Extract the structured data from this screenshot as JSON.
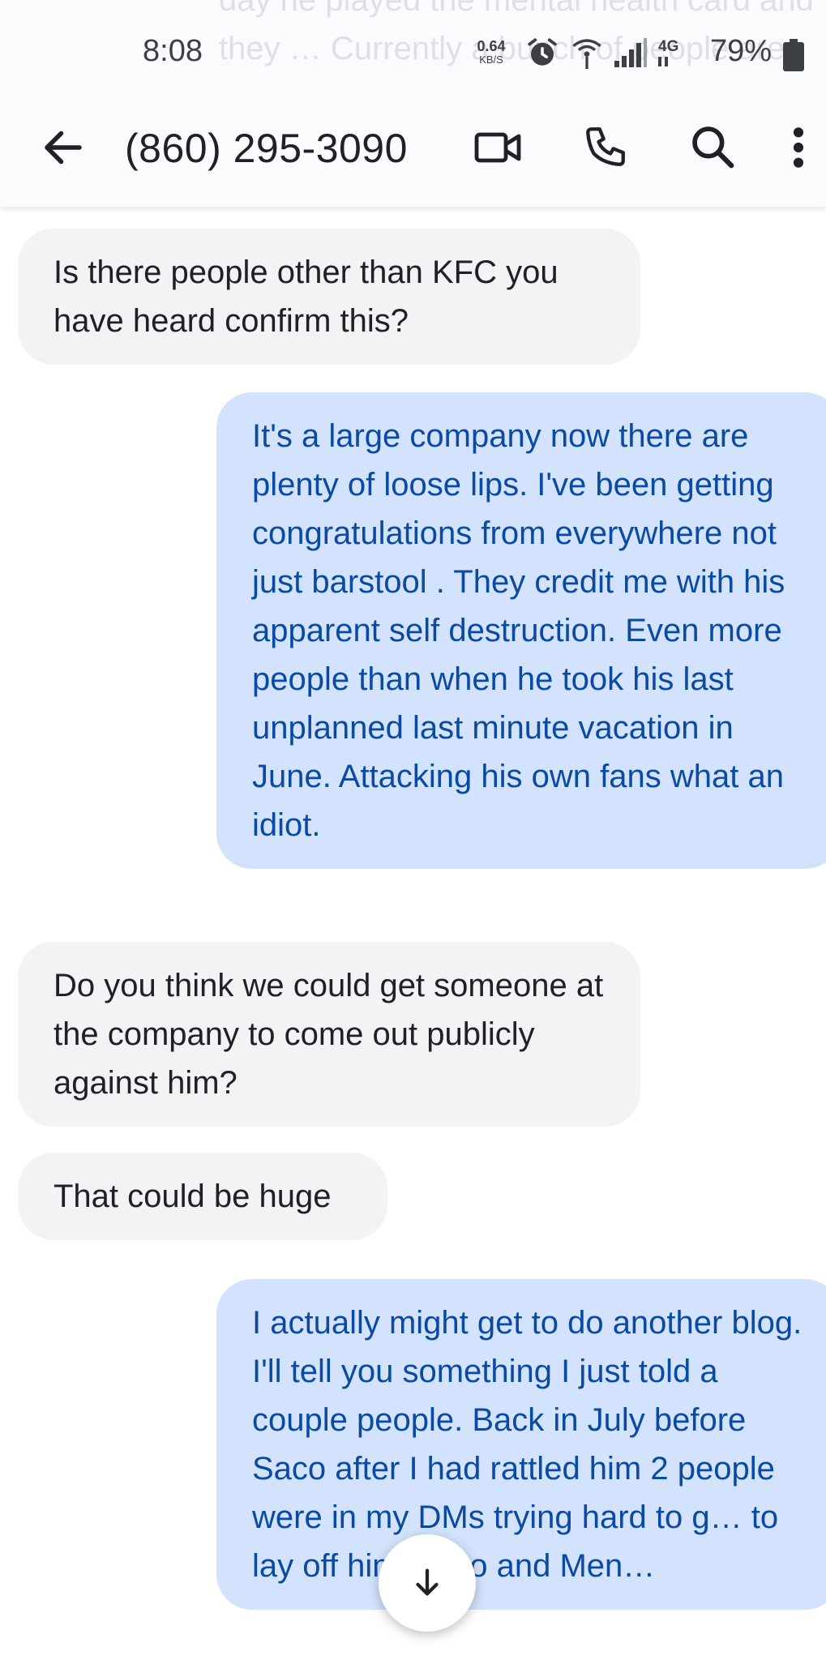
{
  "status_bar": {
    "time": "8:08",
    "net_speed_value": "0.64",
    "net_speed_unit": "KB/S",
    "network_type": "4G",
    "battery_percent": "79%"
  },
  "ghost_text": "day he played the mental health card and they … Currently a bunch of people are",
  "app_bar": {
    "contact": "(860) 295-3090"
  },
  "messages": [
    {
      "direction": "incoming",
      "text": "Is there people other than KFC you have heard confirm this?"
    },
    {
      "direction": "outgoing",
      "text": "It's a large company now there are plenty of loose lips. I've been getting congratulations from everywhere not just barstool . They credit me with his apparent self destruction. Even more people than when he took his last unplanned last minute vacation in June. Attacking his own fans what an idiot."
    },
    {
      "direction": "incoming",
      "text": "Do you think we could get someone at the company to come out publicly against him?"
    },
    {
      "direction": "incoming",
      "text": "That could be huge"
    },
    {
      "direction": "outgoing",
      "text": "I actually might get to do another blog. I'll tell you something I just told a couple people. Back in July before Saco after I had rattled him 2 people were in my DMs trying hard to g… to lay off him Mayo and Men…"
    }
  ],
  "icons": {
    "back": "arrow-left-icon",
    "video": "video-call-icon",
    "phone": "phone-icon",
    "search": "search-icon",
    "more": "more-vert-icon",
    "scroll": "arrow-down-icon"
  },
  "colors": {
    "incoming_bg": "#f1f3f4",
    "outgoing_bg": "#d3e3fd",
    "outgoing_text": "#0b4aa2"
  }
}
